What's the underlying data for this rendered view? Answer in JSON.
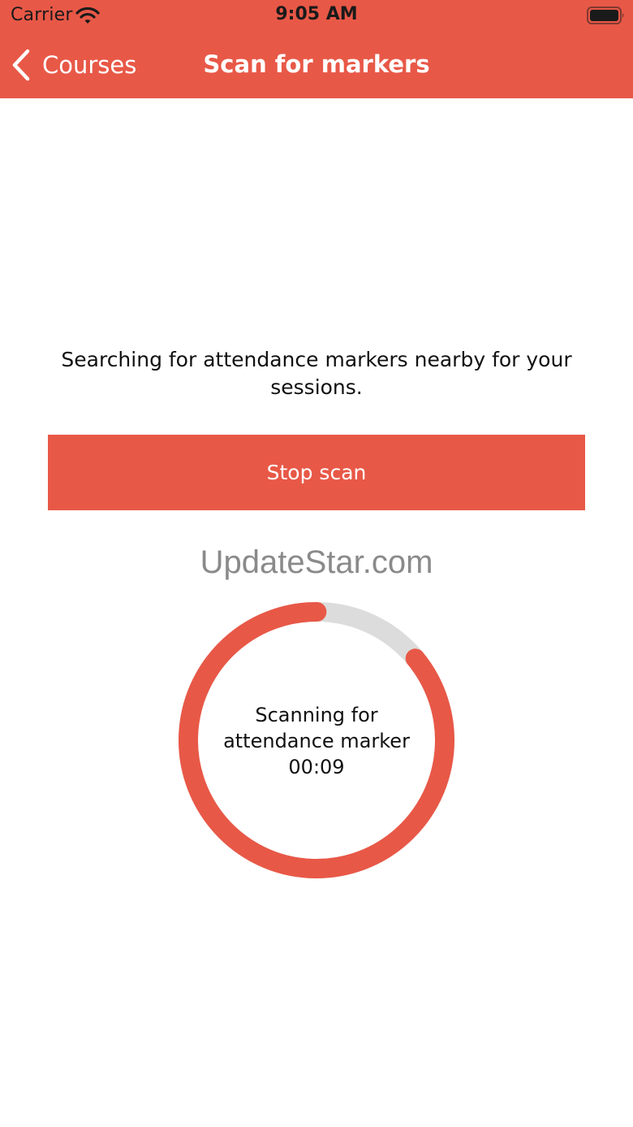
{
  "status_bar": {
    "carrier": "Carrier",
    "time": "9:05 AM"
  },
  "nav": {
    "back_label": "Courses",
    "title": "Scan for markers",
    "back_icon": "chevron-left-icon"
  },
  "main": {
    "message": "Searching for attendance markers nearby for your sessions.",
    "stop_button_label": "Stop scan",
    "watermark": "UpdateStar.com"
  },
  "scan_progress": {
    "label_line1": "Scanning for",
    "label_line2": "attendance marker",
    "timer": "00:09",
    "remaining_fraction": 0.86
  },
  "colors": {
    "accent": "#E85847",
    "track": "#DCDCDC"
  }
}
